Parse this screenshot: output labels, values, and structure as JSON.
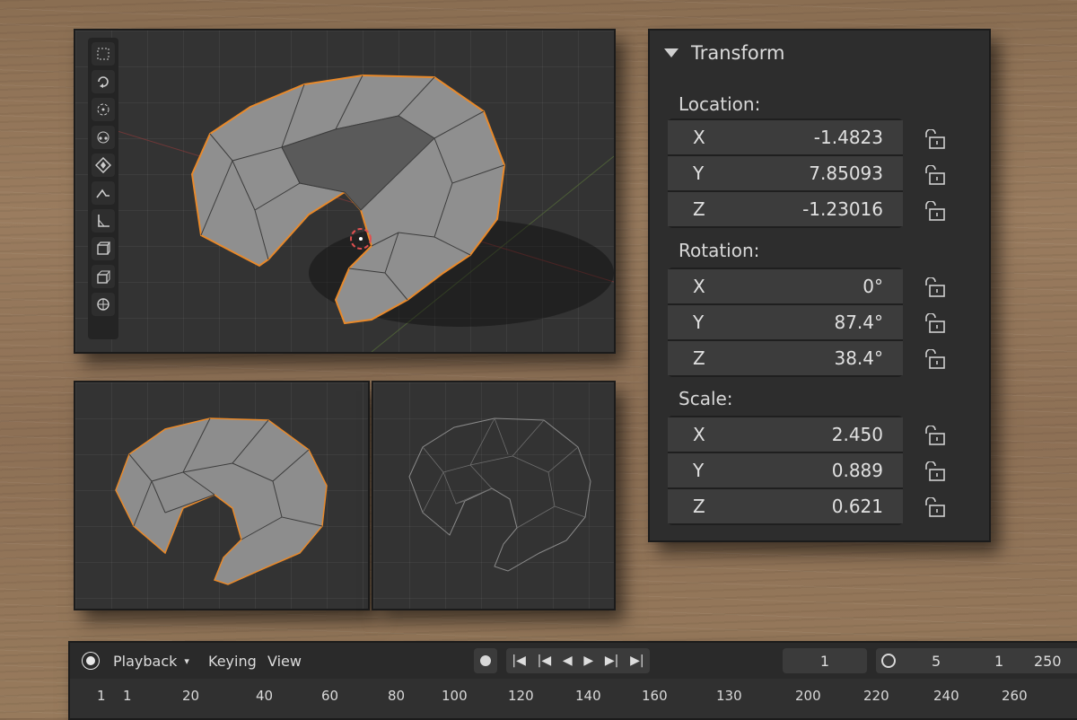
{
  "transform_panel": {
    "title": "Transform",
    "location": {
      "label": "Location:",
      "rows": [
        {
          "axis": "X",
          "value": "-1.4823"
        },
        {
          "axis": "Y",
          "value": "7.85093"
        },
        {
          "axis": "Z",
          "value": "-1.23016"
        }
      ]
    },
    "rotation": {
      "label": "Rotation:",
      "rows": [
        {
          "axis": "X",
          "value": "0°"
        },
        {
          "axis": "Y",
          "value": "87.4°"
        },
        {
          "axis": "Z",
          "value": "38.4°"
        }
      ]
    },
    "scale": {
      "label": "Scale:",
      "rows": [
        {
          "axis": "X",
          "value": "2.450"
        },
        {
          "axis": "Y",
          "value": "0.889"
        },
        {
          "axis": "Z",
          "value": "0.621"
        }
      ]
    }
  },
  "toolbar": {
    "icons": [
      "select-box-icon",
      "rotate-view-icon",
      "cursor-icon",
      "transform-icon",
      "move-icon",
      "annotate-icon",
      "measure-icon",
      "add-cube-icon",
      "extrude-icon",
      "sphere-icon"
    ]
  },
  "timeline": {
    "playback_label": "Playback",
    "keying_label": "Keying",
    "view_label": "View",
    "current_frame": "1",
    "fps_value": "5",
    "start_frame": "1",
    "end_frame": "250",
    "ticks": [
      "1",
      "1",
      "20",
      "40",
      "60",
      "80",
      "100",
      "120",
      "140",
      "160",
      "130",
      "200",
      "220",
      "240",
      "260"
    ]
  },
  "colors": {
    "selection_outline": "#e8892a",
    "panel_bg": "#2b2b2b",
    "field_bg": "#3c3c3c"
  }
}
